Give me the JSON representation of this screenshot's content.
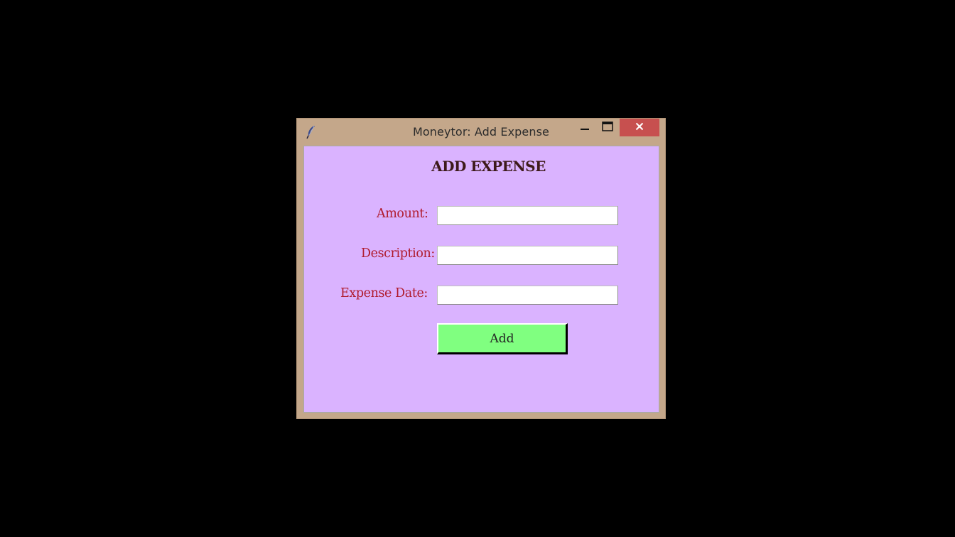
{
  "window": {
    "title": "Moneytor: Add Expense",
    "icons": {
      "app": "feather-icon",
      "minimize": "minimize-icon",
      "maximize": "maximize-icon",
      "close": "close-icon"
    },
    "colors": {
      "frame": "#c4a78a",
      "close_button": "#c7504f",
      "content_background": "#dab3ff"
    }
  },
  "form": {
    "heading": "ADD EXPENSE",
    "amount_label": "Amount:",
    "amount_value": "",
    "description_label": "Description:",
    "description_value": "",
    "date_label": "Expense Date:",
    "date_value": "",
    "add_label": "Add",
    "colors": {
      "label_text": "#b01c2e",
      "heading_text": "#3d1a1a",
      "add_button": "#80ff80"
    }
  }
}
